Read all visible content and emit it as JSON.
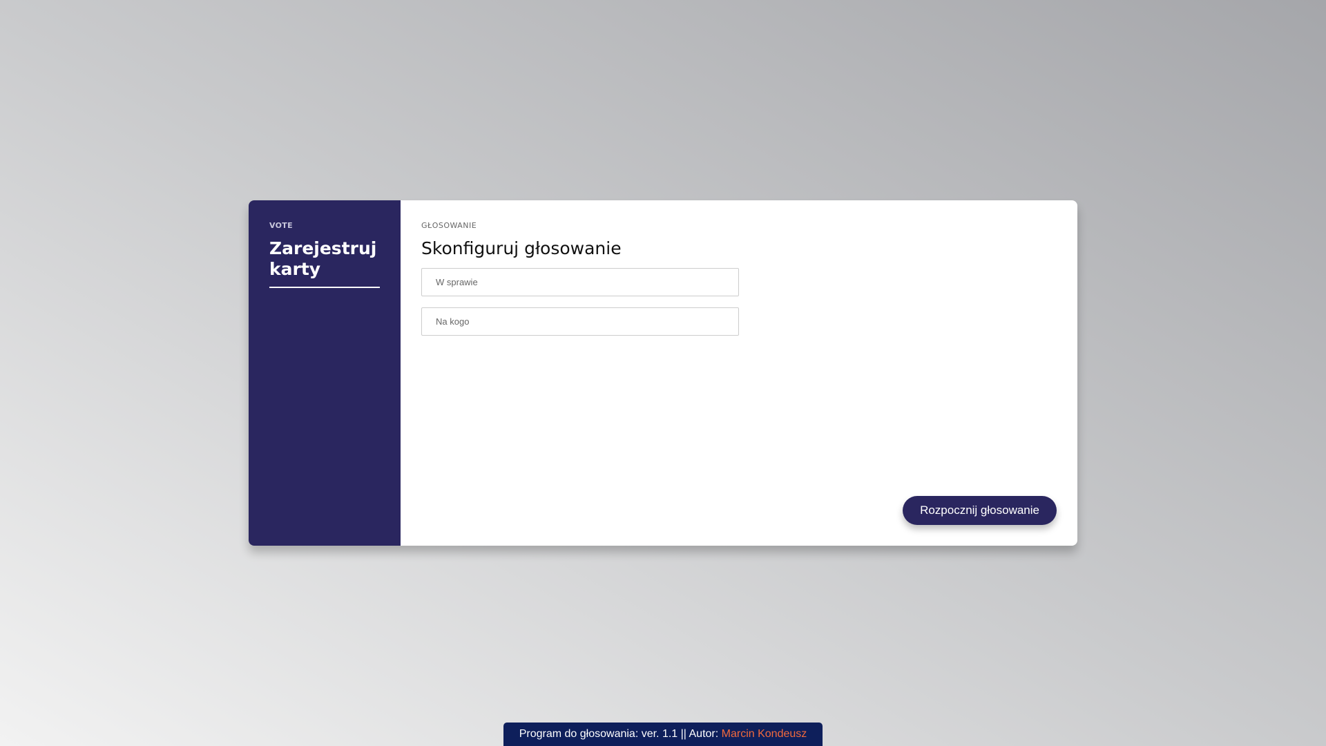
{
  "sidebar": {
    "tag": "VOTE",
    "title": "Zarejestruj karty"
  },
  "main": {
    "tag": "GŁOSOWANIE",
    "title": "Skonfiguruj głosowanie",
    "fields": [
      {
        "value": "",
        "placeholder": "W sprawie"
      },
      {
        "value": "",
        "placeholder": "Na kogo"
      }
    ],
    "start_button_label": "Rozpocznij głosowanie"
  },
  "footer": {
    "text": "Program do głosowania: ver. 1.1 || Autor: ",
    "author_link": "Marcin Kondeusz"
  },
  "colors": {
    "sidebar_bg": "#2a265f",
    "button_bg": "#2a265f",
    "footer_bg": "#0e1f5b",
    "link": "#f26a3d"
  }
}
